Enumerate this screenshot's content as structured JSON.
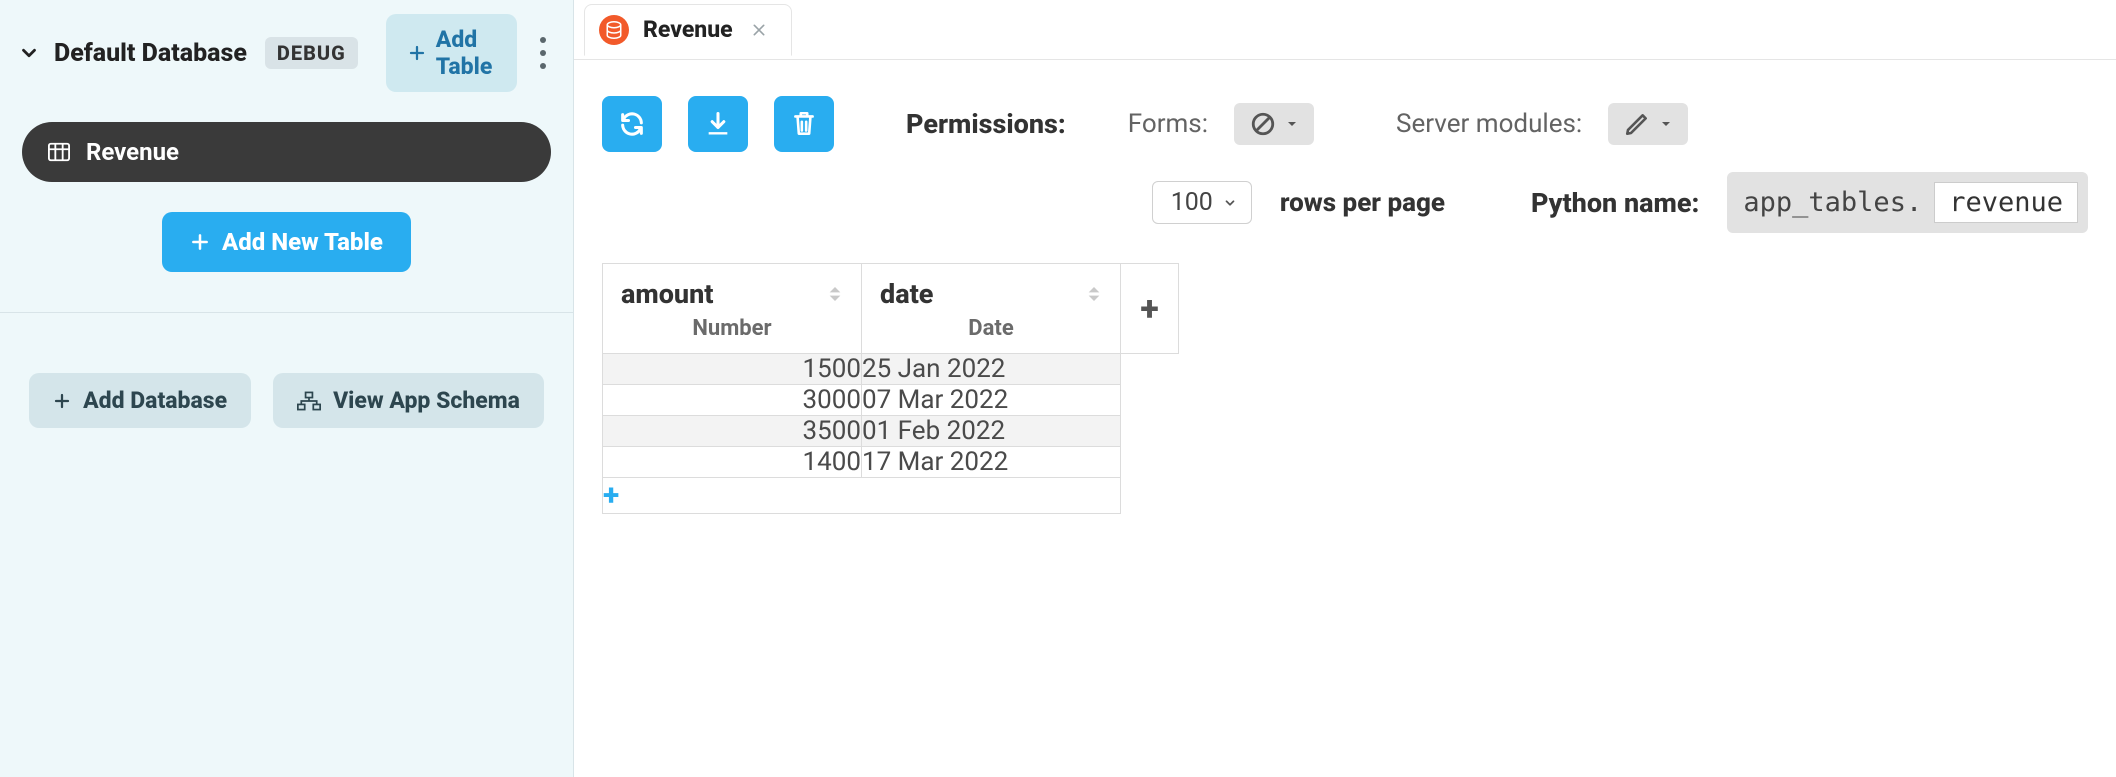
{
  "sidebar": {
    "db_title": "Default Database",
    "debug_badge": "DEBUG",
    "add_table_top": "Add Table",
    "selected_table": "Revenue",
    "add_new_table": "Add New Table",
    "add_database": "Add Database",
    "view_schema": "View App Schema"
  },
  "tabs": {
    "active": "Revenue"
  },
  "toolbar": {
    "permissions_label": "Permissions:",
    "forms_label": "Forms:",
    "server_modules_label": "Server modules:"
  },
  "paging": {
    "rows_per_page_value": "100",
    "rows_per_page_label": "rows per page"
  },
  "python": {
    "label": "Python name:",
    "prefix": "app_tables.",
    "name": "revenue"
  },
  "columns": [
    {
      "name": "amount",
      "type": "Number"
    },
    {
      "name": "date",
      "type": "Date"
    }
  ],
  "rows": [
    {
      "amount": "1500",
      "date": "25 Jan 2022"
    },
    {
      "amount": "3000",
      "date": "07 Mar 2022"
    },
    {
      "amount": "3500",
      "date": "01 Feb 2022"
    },
    {
      "amount": "1400",
      "date": "17 Mar 2022"
    }
  ]
}
